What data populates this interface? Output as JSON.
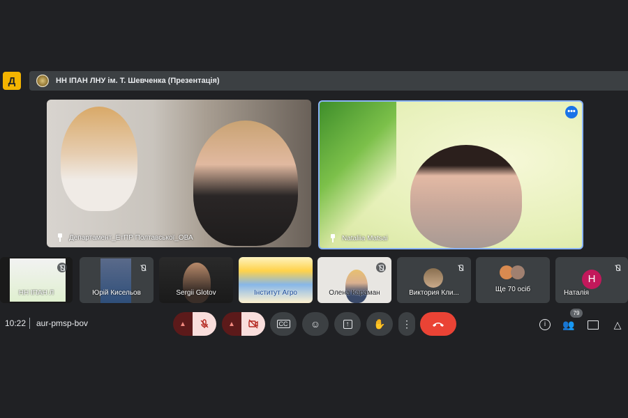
{
  "header": {
    "logo_text": "Д",
    "title": "НН ІПАН ЛНУ ім. Т. Шевченка (Презентація)"
  },
  "main_tiles": [
    {
      "name": "Департамент_ЕтПР Полтавської_ОВА",
      "pinned": true
    },
    {
      "name": "Nataliia Matsai",
      "pinned": true,
      "active_speaker": true
    }
  ],
  "participants_strip": [
    {
      "name": "НН ІПАН ЛНУ ім. Т. Шевченка (Презентація)",
      "label": "НН ІПАН Л",
      "muted": true
    },
    {
      "name": "Юрій Кисельов",
      "muted": true
    },
    {
      "name": "Sergii Glotov",
      "muted": false
    },
    {
      "name": "Інститут Агро",
      "muted": false
    },
    {
      "name": "Олена Караман",
      "muted": true
    },
    {
      "name": "Виктория Кли...",
      "muted": true
    },
    {
      "name": "Ще 70 осіб",
      "muted": false
    },
    {
      "name": "Наталія",
      "initial": "H",
      "muted": true
    }
  ],
  "footer": {
    "time": "10:22",
    "meeting_code": "aur-pmsp-bov",
    "participant_count": "79"
  },
  "colors": {
    "background": "#202124",
    "surface": "#3c4043",
    "accent_blue": "#8ab4f8",
    "hangup_red": "#ea4335",
    "mute_bg": "#f9dedc",
    "avatar_pink": "#c2185b"
  },
  "icons": [
    "mic-off-icon",
    "camera-off-icon",
    "captions-icon",
    "emoji-icon",
    "present-icon",
    "raise-hand-icon",
    "more-options-icon",
    "hangup-icon",
    "info-icon",
    "people-icon",
    "chat-icon",
    "activities-icon",
    "pin-icon"
  ]
}
